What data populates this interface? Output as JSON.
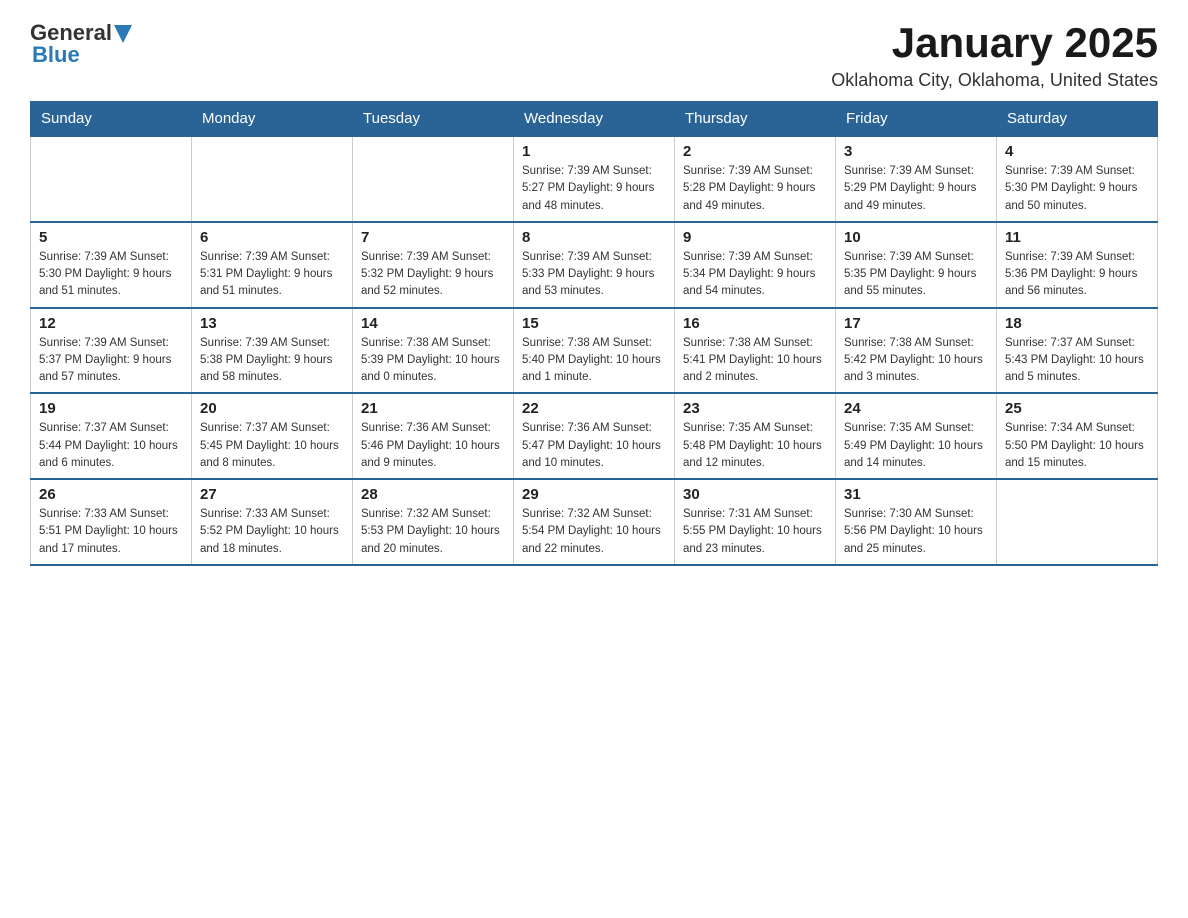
{
  "header": {
    "logo": {
      "text_general": "General",
      "text_blue": "Blue",
      "arrow_icon": "triangle-down"
    },
    "title": "January 2025",
    "location": "Oklahoma City, Oklahoma, United States"
  },
  "weekdays": [
    "Sunday",
    "Monday",
    "Tuesday",
    "Wednesday",
    "Thursday",
    "Friday",
    "Saturday"
  ],
  "weeks": [
    [
      {
        "day": "",
        "info": ""
      },
      {
        "day": "",
        "info": ""
      },
      {
        "day": "",
        "info": ""
      },
      {
        "day": "1",
        "info": "Sunrise: 7:39 AM\nSunset: 5:27 PM\nDaylight: 9 hours\nand 48 minutes."
      },
      {
        "day": "2",
        "info": "Sunrise: 7:39 AM\nSunset: 5:28 PM\nDaylight: 9 hours\nand 49 minutes."
      },
      {
        "day": "3",
        "info": "Sunrise: 7:39 AM\nSunset: 5:29 PM\nDaylight: 9 hours\nand 49 minutes."
      },
      {
        "day": "4",
        "info": "Sunrise: 7:39 AM\nSunset: 5:30 PM\nDaylight: 9 hours\nand 50 minutes."
      }
    ],
    [
      {
        "day": "5",
        "info": "Sunrise: 7:39 AM\nSunset: 5:30 PM\nDaylight: 9 hours\nand 51 minutes."
      },
      {
        "day": "6",
        "info": "Sunrise: 7:39 AM\nSunset: 5:31 PM\nDaylight: 9 hours\nand 51 minutes."
      },
      {
        "day": "7",
        "info": "Sunrise: 7:39 AM\nSunset: 5:32 PM\nDaylight: 9 hours\nand 52 minutes."
      },
      {
        "day": "8",
        "info": "Sunrise: 7:39 AM\nSunset: 5:33 PM\nDaylight: 9 hours\nand 53 minutes."
      },
      {
        "day": "9",
        "info": "Sunrise: 7:39 AM\nSunset: 5:34 PM\nDaylight: 9 hours\nand 54 minutes."
      },
      {
        "day": "10",
        "info": "Sunrise: 7:39 AM\nSunset: 5:35 PM\nDaylight: 9 hours\nand 55 minutes."
      },
      {
        "day": "11",
        "info": "Sunrise: 7:39 AM\nSunset: 5:36 PM\nDaylight: 9 hours\nand 56 minutes."
      }
    ],
    [
      {
        "day": "12",
        "info": "Sunrise: 7:39 AM\nSunset: 5:37 PM\nDaylight: 9 hours\nand 57 minutes."
      },
      {
        "day": "13",
        "info": "Sunrise: 7:39 AM\nSunset: 5:38 PM\nDaylight: 9 hours\nand 58 minutes."
      },
      {
        "day": "14",
        "info": "Sunrise: 7:38 AM\nSunset: 5:39 PM\nDaylight: 10 hours\nand 0 minutes."
      },
      {
        "day": "15",
        "info": "Sunrise: 7:38 AM\nSunset: 5:40 PM\nDaylight: 10 hours\nand 1 minute."
      },
      {
        "day": "16",
        "info": "Sunrise: 7:38 AM\nSunset: 5:41 PM\nDaylight: 10 hours\nand 2 minutes."
      },
      {
        "day": "17",
        "info": "Sunrise: 7:38 AM\nSunset: 5:42 PM\nDaylight: 10 hours\nand 3 minutes."
      },
      {
        "day": "18",
        "info": "Sunrise: 7:37 AM\nSunset: 5:43 PM\nDaylight: 10 hours\nand 5 minutes."
      }
    ],
    [
      {
        "day": "19",
        "info": "Sunrise: 7:37 AM\nSunset: 5:44 PM\nDaylight: 10 hours\nand 6 minutes."
      },
      {
        "day": "20",
        "info": "Sunrise: 7:37 AM\nSunset: 5:45 PM\nDaylight: 10 hours\nand 8 minutes."
      },
      {
        "day": "21",
        "info": "Sunrise: 7:36 AM\nSunset: 5:46 PM\nDaylight: 10 hours\nand 9 minutes."
      },
      {
        "day": "22",
        "info": "Sunrise: 7:36 AM\nSunset: 5:47 PM\nDaylight: 10 hours\nand 10 minutes."
      },
      {
        "day": "23",
        "info": "Sunrise: 7:35 AM\nSunset: 5:48 PM\nDaylight: 10 hours\nand 12 minutes."
      },
      {
        "day": "24",
        "info": "Sunrise: 7:35 AM\nSunset: 5:49 PM\nDaylight: 10 hours\nand 14 minutes."
      },
      {
        "day": "25",
        "info": "Sunrise: 7:34 AM\nSunset: 5:50 PM\nDaylight: 10 hours\nand 15 minutes."
      }
    ],
    [
      {
        "day": "26",
        "info": "Sunrise: 7:33 AM\nSunset: 5:51 PM\nDaylight: 10 hours\nand 17 minutes."
      },
      {
        "day": "27",
        "info": "Sunrise: 7:33 AM\nSunset: 5:52 PM\nDaylight: 10 hours\nand 18 minutes."
      },
      {
        "day": "28",
        "info": "Sunrise: 7:32 AM\nSunset: 5:53 PM\nDaylight: 10 hours\nand 20 minutes."
      },
      {
        "day": "29",
        "info": "Sunrise: 7:32 AM\nSunset: 5:54 PM\nDaylight: 10 hours\nand 22 minutes."
      },
      {
        "day": "30",
        "info": "Sunrise: 7:31 AM\nSunset: 5:55 PM\nDaylight: 10 hours\nand 23 minutes."
      },
      {
        "day": "31",
        "info": "Sunrise: 7:30 AM\nSunset: 5:56 PM\nDaylight: 10 hours\nand 25 minutes."
      },
      {
        "day": "",
        "info": ""
      }
    ]
  ]
}
